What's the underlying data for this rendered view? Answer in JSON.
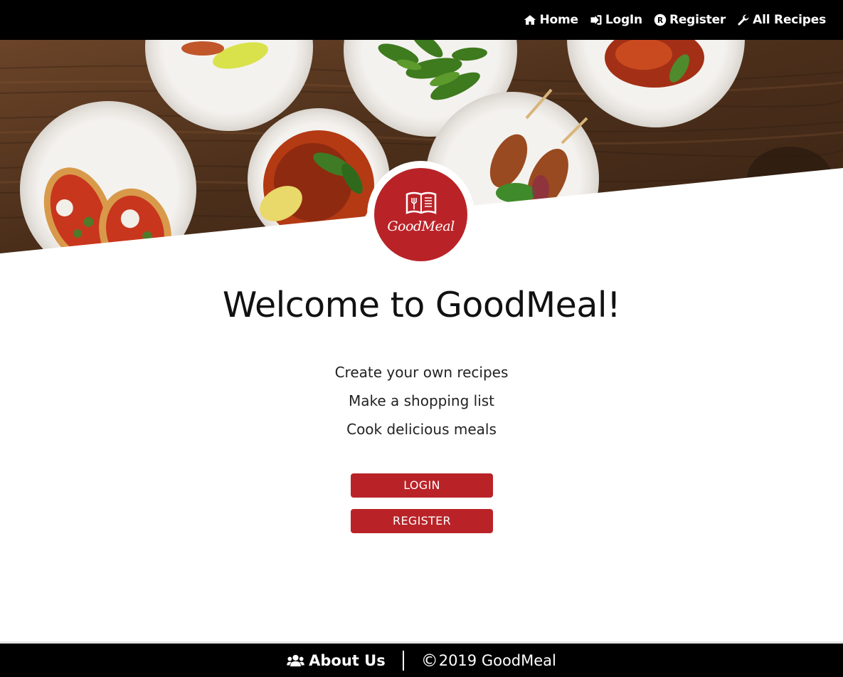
{
  "nav": {
    "items": [
      {
        "label": "Home",
        "icon": "home-icon"
      },
      {
        "label": "LogIn",
        "icon": "sign-in-icon"
      },
      {
        "label": "Register",
        "icon": "registered-icon"
      },
      {
        "label": "All Recipes",
        "icon": "wrench-icon"
      }
    ]
  },
  "logo": {
    "text": "GoodMeal"
  },
  "main": {
    "title": "Welcome to GoodMeal!",
    "features": [
      "Create your own recipes",
      "Make a shopping list",
      "Cook delicious meals"
    ],
    "login_label": "LOGIN",
    "register_label": "REGISTER"
  },
  "footer": {
    "about_label": "About Us",
    "copyright_symbol": "©",
    "copyright_text": "2019 GoodMeal"
  },
  "colors": {
    "accent": "#b92328",
    "nav_bg": "#000000",
    "footer_bg": "#000000"
  }
}
